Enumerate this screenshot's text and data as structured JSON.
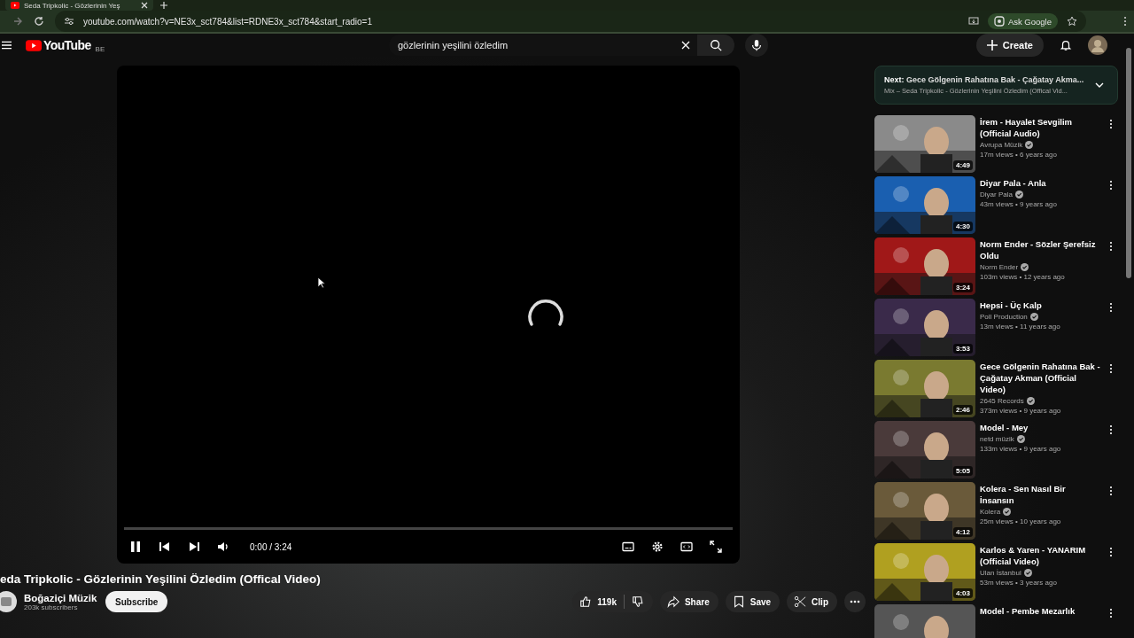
{
  "browser": {
    "tab_title": "Seda Tripkolic - Gözlerinin Yeş",
    "url": "youtube.com/watch?v=NE3x_sct784&list=RDNE3x_sct784&start_radio=1",
    "ask_google": "Ask Google"
  },
  "header": {
    "logo": "YouTube",
    "region": "BE",
    "search": {
      "value": "gözlerinin yeşilini özledim"
    },
    "create": "Create"
  },
  "player": {
    "playing": true,
    "time": "0:00 / 3:24"
  },
  "video": {
    "title": "eda Tripkolic - Gözlerinin Yeşilini Özledim (Offical Video)",
    "channel": "Boğaziçi Müzik",
    "subscribers": "203k subscribers",
    "subscribe": "Subscribe",
    "likes": "119k",
    "actions": [
      {
        "kind": "share",
        "label": "Share"
      },
      {
        "kind": "save",
        "label": "Save"
      },
      {
        "kind": "clip",
        "label": "Clip"
      }
    ]
  },
  "up_next": {
    "next": "**Next:** Gece Gölgenin Rahatına Bak - Çağatay Akma...",
    "mix": "Mix – Seda Tripkolic - Gözlerinin Yeşilini Özledim (Offical Vid..."
  },
  "recommendations": [
    {
      "title": "İrem - Hayalet Sevgilim (Official Audio)",
      "channel": "Avrupa Müzik",
      "verified": true,
      "meta": "17m views • 6 years ago",
      "duration": "4:49"
    },
    {
      "title": "Diyar Pala - Anla",
      "channel": "Diyar Pala",
      "verified": true,
      "meta": "43m views • 9 years ago",
      "duration": "4:30"
    },
    {
      "title": "Norm Ender - Sözler Şerefsiz Oldu",
      "channel": "Norm Ender",
      "verified": true,
      "meta": "103m views • 12 years ago",
      "duration": "3:24"
    },
    {
      "title": "Hepsi - Üç Kalp",
      "channel": "Poll Production",
      "verified": true,
      "meta": "13m views • 11 years ago",
      "duration": "3:53"
    },
    {
      "title": "Gece Gölgenin Rahatına Bak - Çağatay Akman (Official  Video)",
      "channel": "2645 Records",
      "verified": true,
      "meta": "373m views • 9 years ago",
      "duration": "2:46"
    },
    {
      "title": "Model - Mey",
      "channel": "netd müzik",
      "verified": true,
      "meta": "133m views • 9 years ago",
      "duration": "5:05"
    },
    {
      "title": "Kolera - Sen Nasıl Bir İnsansın",
      "channel": "Kolera",
      "verified": true,
      "meta": "25m views • 10 years ago",
      "duration": "4:12"
    },
    {
      "title": "Karlos & Yaren - YANARIM (Official Video)",
      "channel": "Ulan İstanbul",
      "verified": true,
      "meta": "53m views • 3 years ago",
      "duration": "4:03"
    },
    {
      "title": "Model - Pembe Mezarlık"
    }
  ]
}
